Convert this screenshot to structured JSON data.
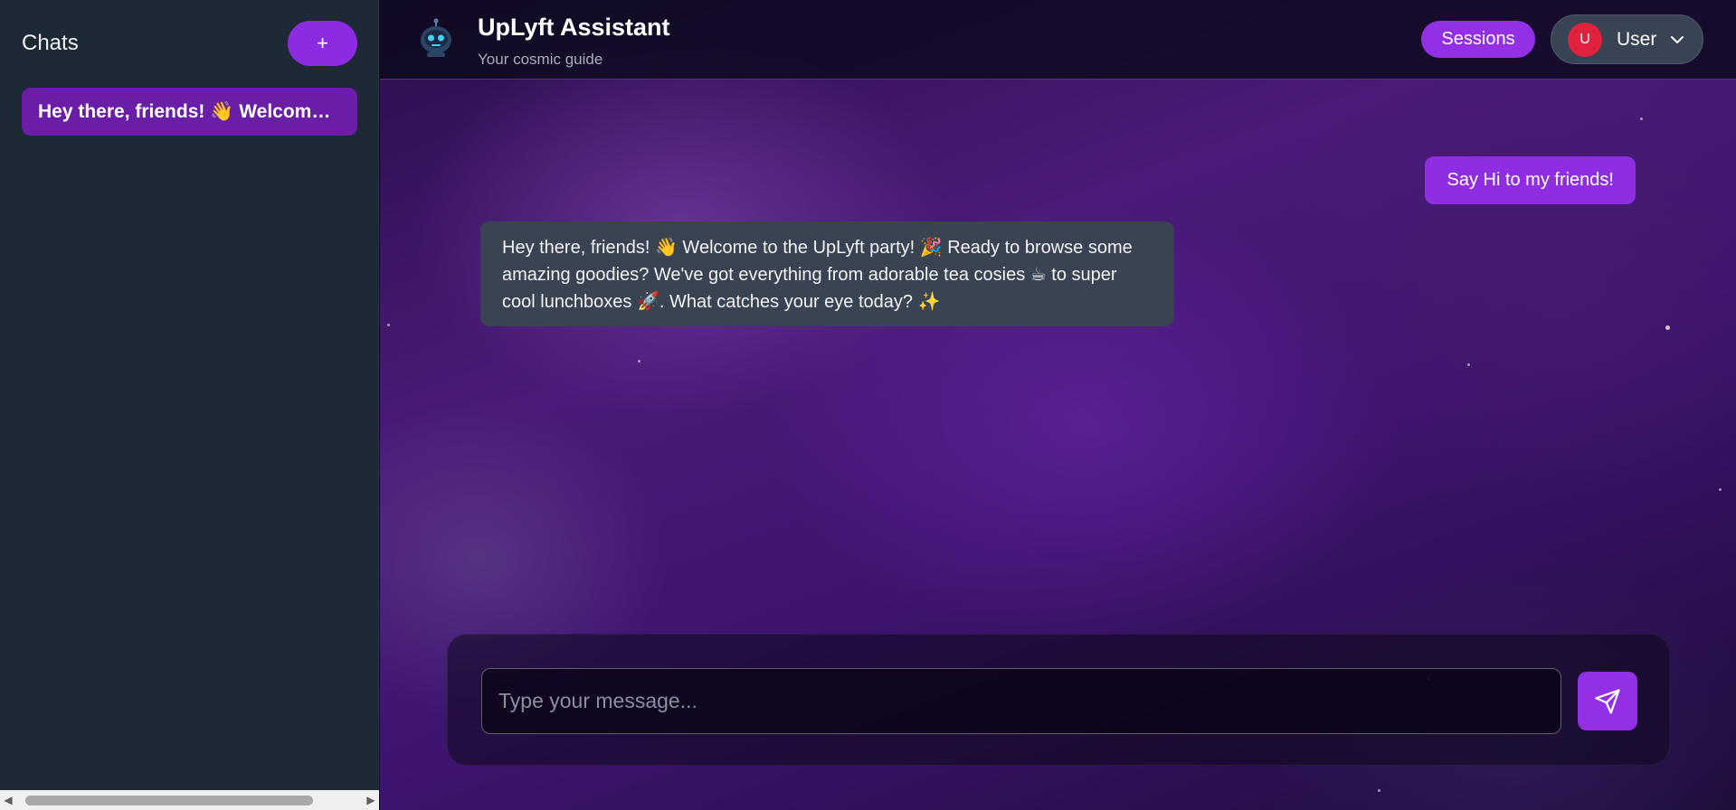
{
  "sidebar": {
    "title": "Chats",
    "new_chat_label": "+",
    "chats": [
      {
        "label": "Hey there, friends! 👋 Welcome to the UpLyft party! 🎉"
      }
    ]
  },
  "header": {
    "title": "UpLyft Assistant",
    "subtitle": "Your cosmic guide",
    "sessions_label": "Sessions",
    "user": {
      "initial": "U",
      "name": "User"
    }
  },
  "messages": [
    {
      "role": "user",
      "text": "Say Hi to my friends!"
    },
    {
      "role": "assistant",
      "text": "Hey there, friends! 👋 Welcome to the UpLyft party! 🎉 Ready to browse some amazing goodies? We've got everything from adorable tea cosies ☕ to super cool lunchboxes 🚀. What catches your eye today? ✨"
    }
  ],
  "composer": {
    "placeholder": "Type your message...",
    "value": ""
  },
  "colors": {
    "accent": "#9330e6",
    "sidebar_bg": "#1e2936",
    "active_chat": "#6a1ea8",
    "assistant_bubble": "#3a4352",
    "avatar": "#e0223f"
  },
  "icons": {
    "logo": "robot-icon",
    "send": "paper-plane-icon",
    "user_menu": "chevron-down-icon"
  }
}
